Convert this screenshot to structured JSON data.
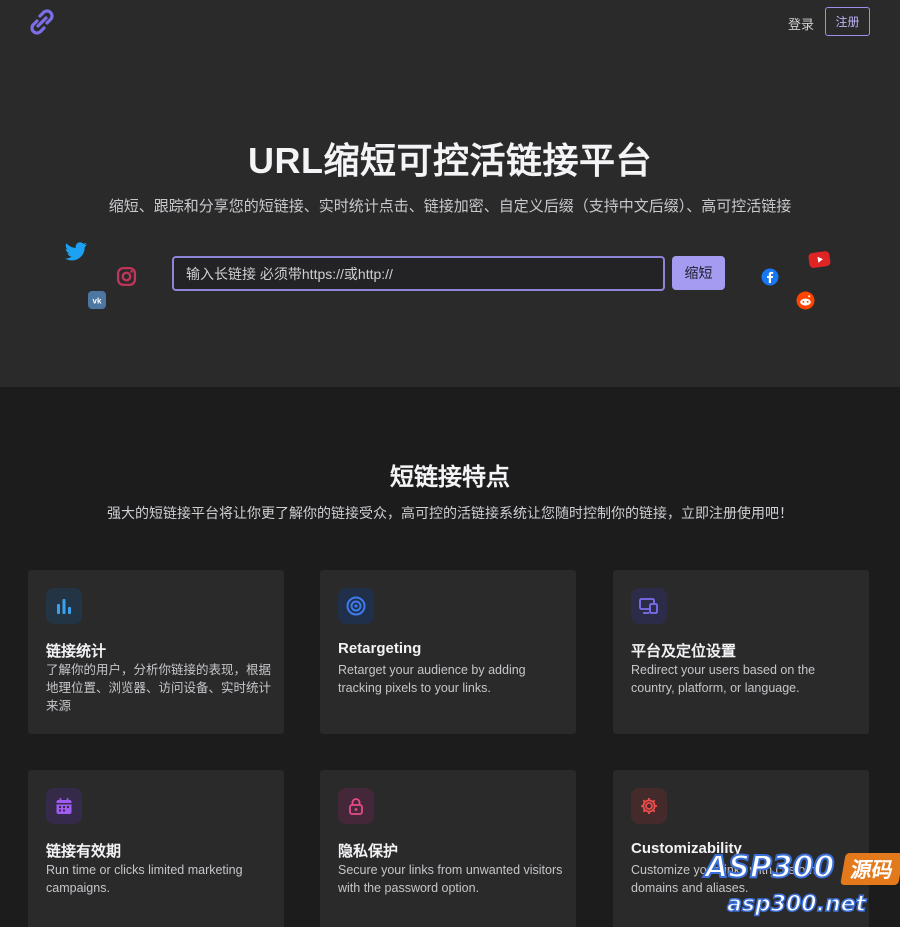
{
  "nav": {
    "login_label": "登录",
    "register_label": "注册"
  },
  "hero": {
    "title": "URL缩短可控活链接平台",
    "subtitle": "缩短、跟踪和分享您的短链接、实时统计点击、链接加密、自定义后缀（支持中文后缀）、高可控活链接",
    "input_placeholder": "输入长链接 必须带https://或http://",
    "shorten_label": "缩短"
  },
  "features": {
    "title": "短链接特点",
    "subtitle": "强大的短链接平台将让你更了解你的链接受众，高可控的活链接系统让您随时控制你的链接，立即注册使用吧！",
    "cards": [
      {
        "icon": "bar-chart-icon",
        "title": "链接统计",
        "desc": "了解你的用户，分析你链接的表现，根据地理位置、浏览器、访问设备、实时统计来源"
      },
      {
        "icon": "target-icon",
        "title": "Retargeting",
        "desc": "Retarget your audience by adding tracking pixels to your links."
      },
      {
        "icon": "devices-icon",
        "title": "平台及定位设置",
        "desc": "Redirect your users based on the country, platform, or language."
      },
      {
        "icon": "calendar-icon",
        "title": "链接有效期",
        "desc": "Run time or clicks limited marketing campaigns."
      },
      {
        "icon": "lock-icon",
        "title": "隐私保护",
        "desc": "Secure your links from unwanted visitors with the password option."
      },
      {
        "icon": "gear-icon",
        "title": "Customizability",
        "desc": "Customize your links with custom domains and aliases."
      }
    ]
  },
  "watermark": {
    "brand": "ASP300",
    "badge": "源码",
    "domain": "asp300.net"
  },
  "colors": {
    "hero_bg": "#2a2a2b",
    "page_bg": "#1c1c1d",
    "accent": "#a59cf2"
  }
}
